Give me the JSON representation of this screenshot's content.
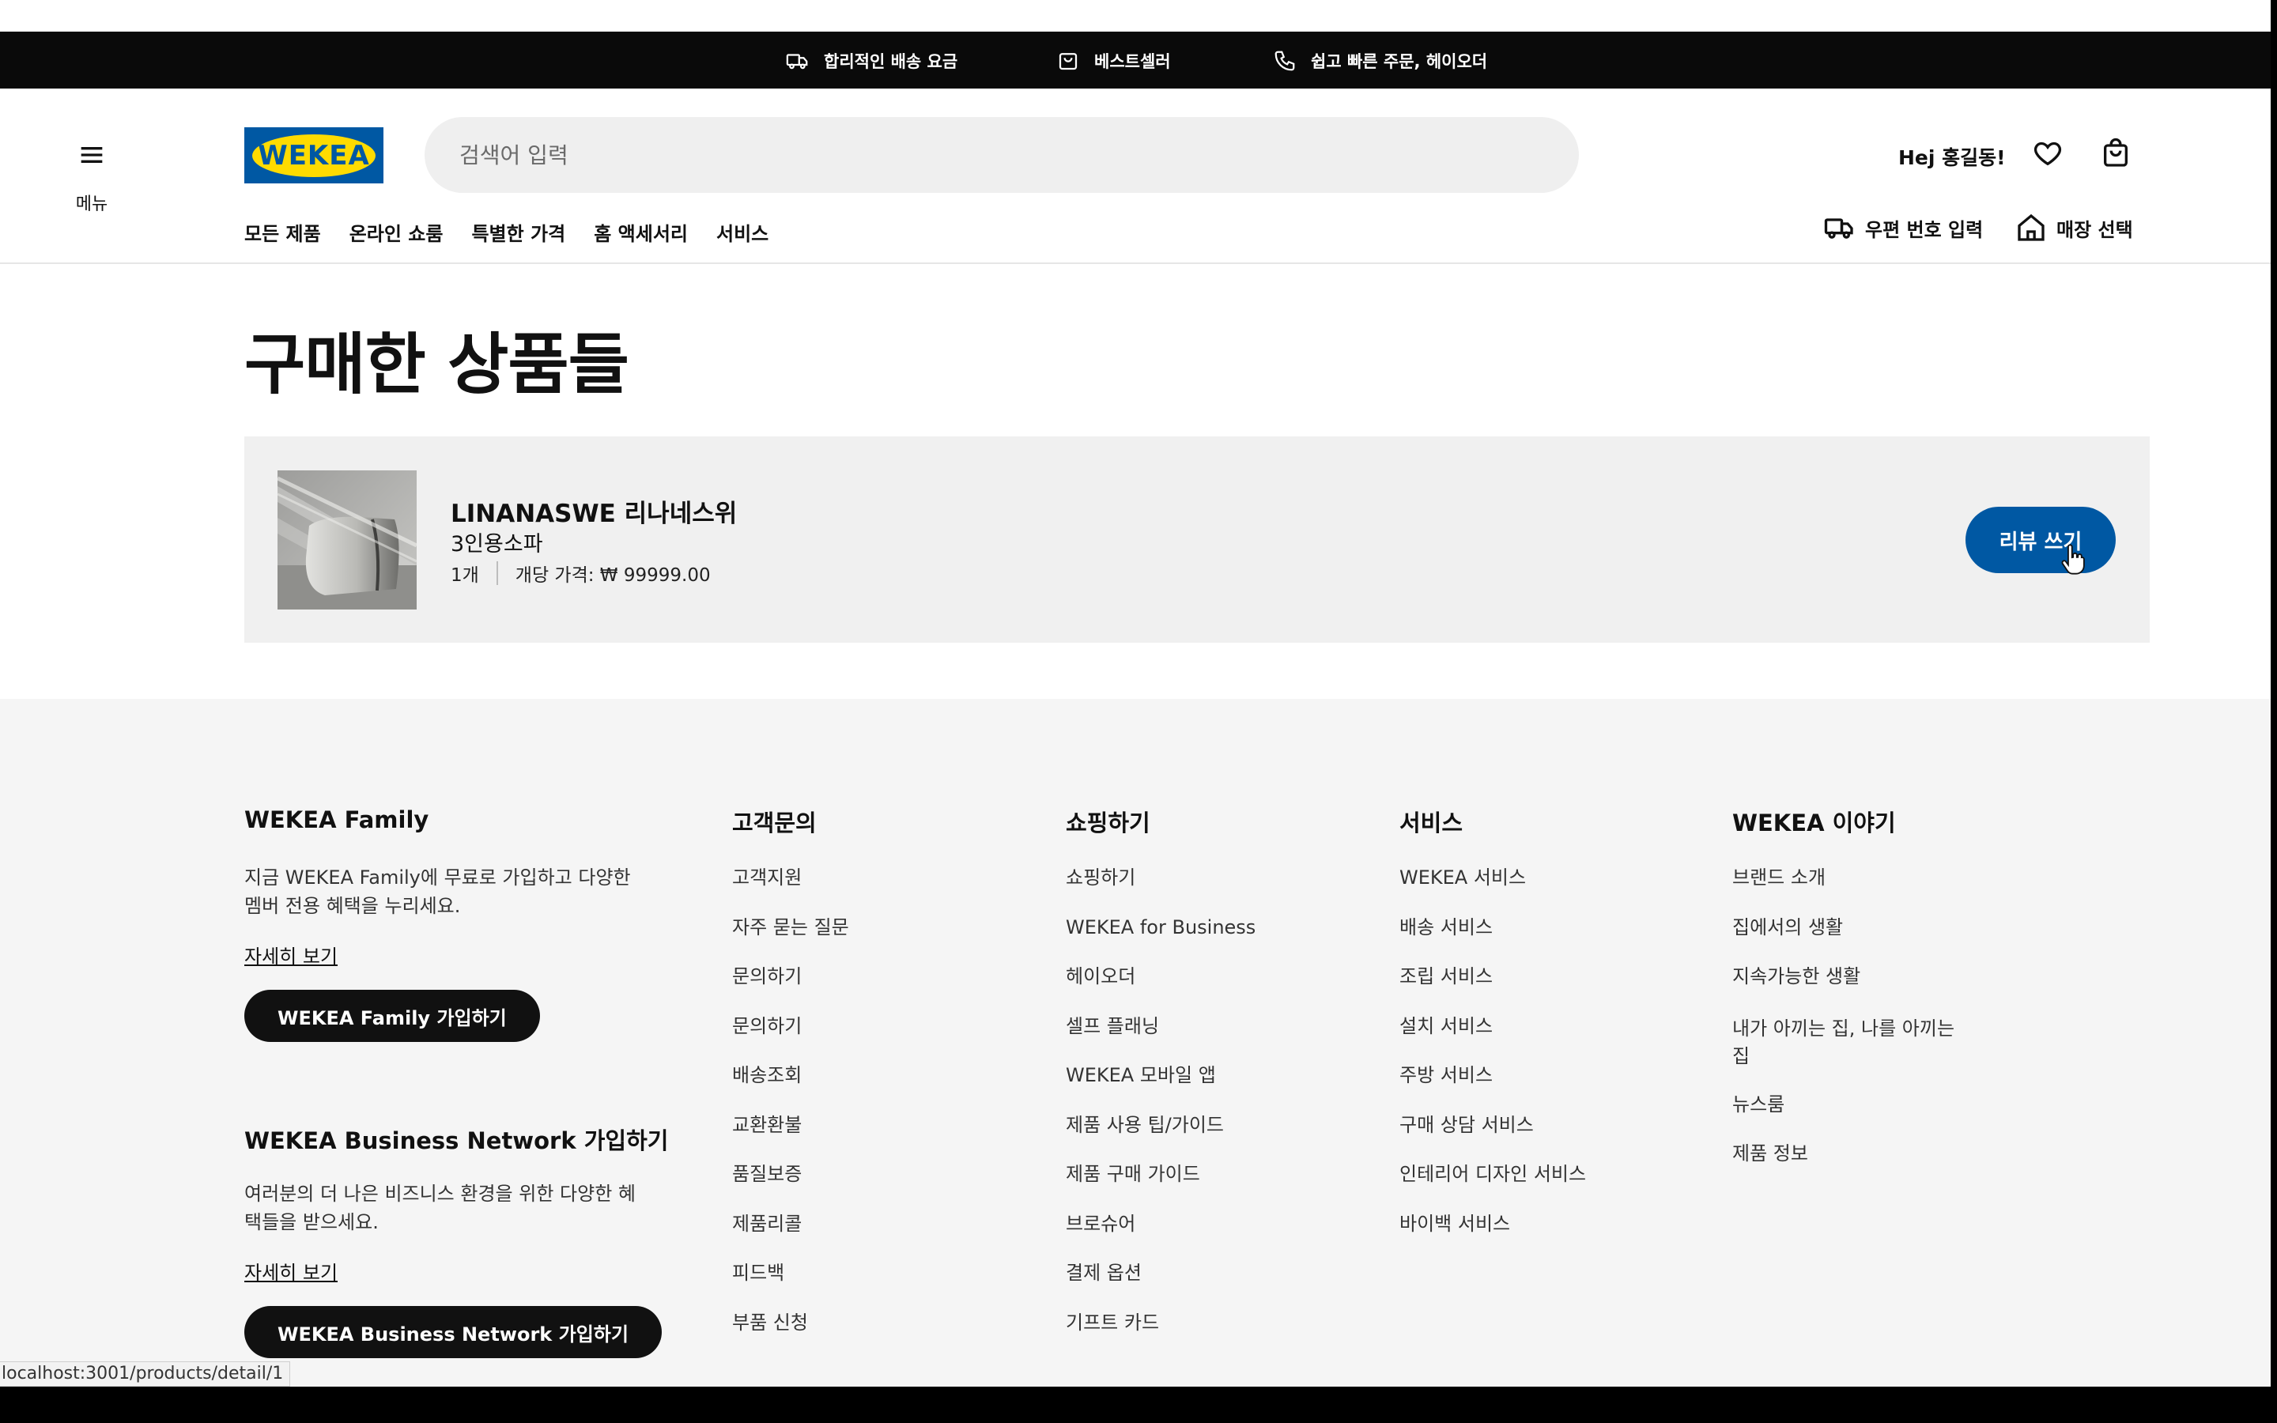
{
  "promo": [
    {
      "icon": "truck-icon",
      "label": "합리적인 배송 요금"
    },
    {
      "icon": "shopping-bag-icon",
      "label": "베스트셀러"
    },
    {
      "icon": "phone-icon",
      "label": "쉽고 빠른 주문, 헤이오더"
    }
  ],
  "header": {
    "menu_label": "메뉴",
    "logo_text": "WEKEA",
    "search_placeholder": "검색어 입력",
    "greeting": "Hej 홍길동!",
    "nav": [
      "모든 제품",
      "온라인 쇼룸",
      "특별한 가격",
      "홈 액세서리",
      "서비스"
    ],
    "postal_label": "우편 번호 입력",
    "store_label": "매장 선택"
  },
  "main": {
    "title": "구매한 상품들",
    "order": {
      "name": "LINANASWE 리나네스위",
      "description": "3인용소파",
      "quantity": "1개",
      "unit_price": "개당 가격: ₩ 99999.00",
      "review_button": "리뷰 쓰기"
    }
  },
  "footer": {
    "family": {
      "title": "WEKEA Family",
      "text": "지금 WEKEA Family에 무료로 가입하고 다양한 멤버 전용 혜택을 누리세요.",
      "more": "자세히 보기",
      "button": "WEKEA Family 가입하기"
    },
    "business": {
      "title": "WEKEA Business Network 가입하기",
      "text": "여러분의 더 나은 비즈니스 환경을 위한 다양한 혜택들을 받으세요.",
      "more": "자세히 보기",
      "button": "WEKEA Business Network 가입하기"
    },
    "columns": [
      {
        "title": "고객문의",
        "items": [
          "고객지원",
          "자주 묻는 질문",
          "문의하기",
          "문의하기",
          "배송조회",
          "교환환불",
          "품질보증",
          "제품리콜",
          "피드백",
          "부품 신청"
        ]
      },
      {
        "title": "쇼핑하기",
        "items": [
          "쇼핑하기",
          "WEKEA for Business",
          "헤이오더",
          "셀프 플래닝",
          "WEKEA 모바일 앱",
          "제품 사용 팁/가이드",
          "제품 구매 가이드",
          "브로슈어",
          "결제 옵션",
          "기프트 카드"
        ]
      },
      {
        "title": "서비스",
        "items": [
          "WEKEA 서비스",
          "배송 서비스",
          "조립 서비스",
          "설치 서비스",
          "주방 서비스",
          "구매 상담 서비스",
          "인테리어 디자인 서비스",
          "바이백 서비스"
        ]
      },
      {
        "title": "WEKEA 이야기",
        "items": [
          "브랜드 소개",
          "집에서의 생활",
          "지속가능한 생활",
          "내가 아끼는 집, 나를 아끼는 집",
          "뉴스룸",
          "제품 정보"
        ]
      }
    ]
  },
  "status_url": "localhost:3001/products/detail/1",
  "colors": {
    "brand_blue": "#0058a3",
    "brand_yellow": "#ffdb00"
  }
}
